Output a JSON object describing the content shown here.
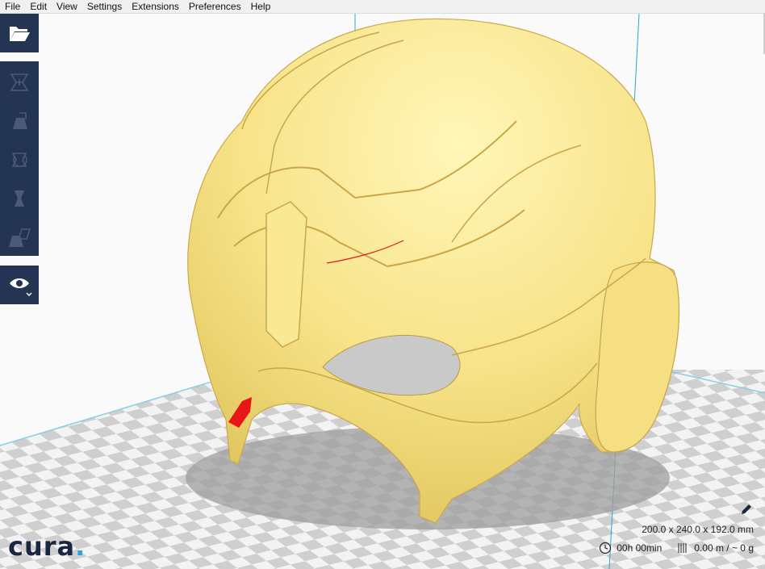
{
  "menu": {
    "items": [
      "File",
      "Edit",
      "View",
      "Settings",
      "Extensions",
      "Preferences",
      "Help"
    ]
  },
  "toolbar": {
    "open_icon": "folder-open-icon",
    "tools": [
      "translate-tool-icon",
      "scale-tool-icon",
      "rotate-tool-icon",
      "mirror-tool-icon",
      "per-model-settings-icon"
    ],
    "view_icon": "eye-icon"
  },
  "logo": {
    "text": "cura",
    "dot": "."
  },
  "status": {
    "dimensions": "200.0 x 240.0 x 192.0 mm",
    "time": "00h 00min",
    "material": "0.00 m / ~ 0 g"
  },
  "colors": {
    "sidebar": "#243453",
    "model": "#f7e389",
    "overhang": "#e81717",
    "axis": "#2aa6d0"
  }
}
